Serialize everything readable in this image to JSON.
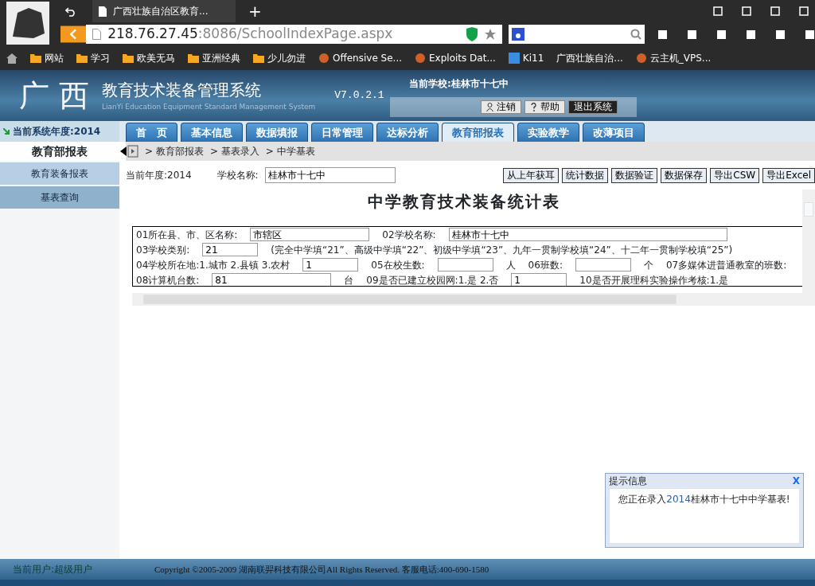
{
  "browser": {
    "tab_title": "广西壮族自治区教育...",
    "new_tab": "+",
    "url_host": "218.76.27.45",
    "url_rest": ":8086/SchoolIndexPage.aspx",
    "bookmarks": [
      {
        "label": "网站",
        "kind": "folder"
      },
      {
        "label": "学习",
        "kind": "folder"
      },
      {
        "label": "欧美无马",
        "kind": "folder"
      },
      {
        "label": "亚洲经典",
        "kind": "folder"
      },
      {
        "label": "少儿勿进",
        "kind": "folder"
      },
      {
        "label": "Offensive Se...",
        "kind": "site"
      },
      {
        "label": "Exploits Dat...",
        "kind": "site"
      },
      {
        "label": "Ki11",
        "kind": "ct"
      },
      {
        "label": "广西壮族自治...",
        "kind": "plain"
      },
      {
        "label": "云主机_VPS...",
        "kind": "site"
      }
    ]
  },
  "header": {
    "logo": "广 西",
    "title": "教育技术装备管理系统",
    "subtitle": "LianYi Education Equipment Standard Management System",
    "version": "V7.0.2.1",
    "school": "当前学校:桂林市十七中",
    "buttons": [
      {
        "label": "注销",
        "kind": "user"
      },
      {
        "label": "帮助",
        "kind": "help"
      },
      {
        "label": "退出系统",
        "kind": "exit"
      }
    ]
  },
  "year_label": "当前系统年度:2014",
  "tabs": [
    {
      "label": "首　页",
      "selected": false
    },
    {
      "label": "基本信息",
      "selected": false
    },
    {
      "label": "数据填报",
      "selected": false
    },
    {
      "label": "日常管理",
      "selected": false
    },
    {
      "label": "达标分析",
      "selected": false
    },
    {
      "label": "教育部报表",
      "selected": true
    },
    {
      "label": "实验教学",
      "selected": false
    },
    {
      "label": "改薄项目",
      "selected": false
    }
  ],
  "sidebar": {
    "title": "教育部报表",
    "items": [
      {
        "label": "教育装备报表",
        "selected": true
      },
      {
        "label": "基表查询",
        "selected": false
      }
    ]
  },
  "breadcrumb": [
    "> 教育部报表",
    "> 基表录入",
    "> 中学基表"
  ],
  "toolbar": {
    "year_label": "当前年度:",
    "year": "2014",
    "school_label": "学校名称:",
    "school": "桂林市十七中",
    "buttons": [
      "从上年获耳",
      "统计数据",
      "数据验证",
      "数据保存",
      "导出CSW",
      "导出Excel"
    ]
  },
  "form": {
    "title": "中学教育技术装备统计表",
    "rows": [
      {
        "questions": [
          {
            "kind": "input",
            "label": "01所在县、市、区名称:",
            "value": "市辖区"
          },
          {
            "kind": "input",
            "label": "02学校名称:",
            "value": "桂林市十七中"
          }
        ]
      },
      {
        "questions": [
          {
            "kind": "input",
            "label": "03学校类别:",
            "value": "21",
            "note": "(完全中学填“21”、高级中学填“22”、初级中学填“23”、九年一贯制学校填“24”、十二年一贯制学校填“25”)"
          }
        ]
      },
      {
        "questions": [
          {
            "kind": "input",
            "label": "04学校所在地:1.城市 2.县镇 3.农村",
            "value": "1"
          },
          {
            "kind": "input",
            "label": "05在校生数:",
            "unit": "人"
          },
          {
            "kind": "input",
            "label": "06班数:",
            "unit": "个"
          },
          {
            "kind": "text",
            "label": "07多媒体进普通教室的班数:"
          }
        ]
      },
      {
        "questions": [
          {
            "kind": "input",
            "label": "08计算机台数:",
            "value": "81",
            "unit": "台"
          },
          {
            "kind": "input",
            "label": "09是否已建立校园网:1.是 2.否",
            "value": "1"
          },
          {
            "kind": "text",
            "label": "10是否开展理科实验操作考核:1.是"
          }
        ]
      }
    ]
  },
  "notice": {
    "title": "提示信息",
    "close": "X",
    "message_pre": "您正在录入",
    "year": "2014",
    "message_post": "桂林市十七中中学基表!"
  },
  "footer": {
    "user": "当前用户:超级用户",
    "copyright": "Copyright ©2005-2009 湖南联羿科技有限公司All Rights Reserved. 客服电话:400-690-1580"
  }
}
